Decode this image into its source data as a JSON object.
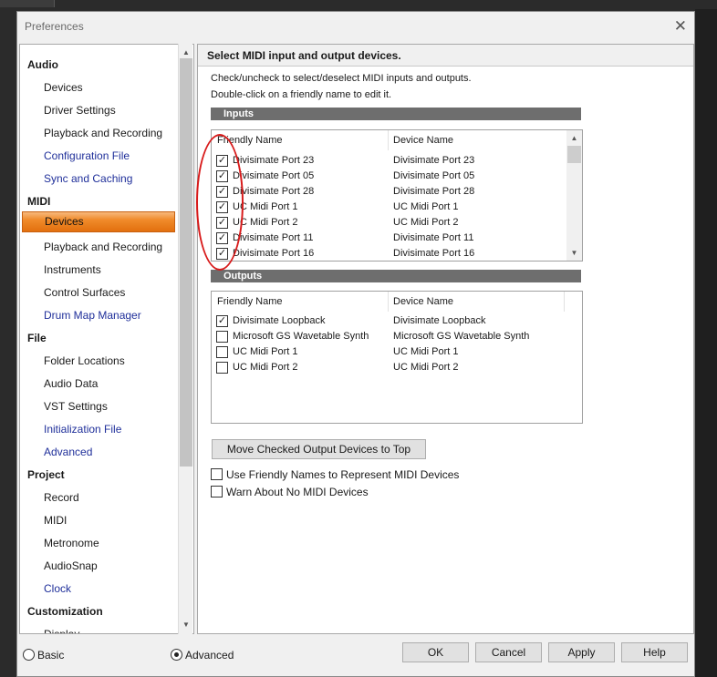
{
  "window": {
    "title": "Preferences"
  },
  "tree": [
    {
      "label": "Audio",
      "type": "cat"
    },
    {
      "label": "Devices",
      "type": "sub"
    },
    {
      "label": "Driver Settings",
      "type": "sub"
    },
    {
      "label": "Playback and Recording",
      "type": "sub"
    },
    {
      "label": "Configuration File",
      "type": "link"
    },
    {
      "label": "Sync and Caching",
      "type": "link"
    },
    {
      "label": "MIDI",
      "type": "cat"
    },
    {
      "label": "Devices",
      "type": "selected"
    },
    {
      "label": "Playback and Recording",
      "type": "sub"
    },
    {
      "label": "Instruments",
      "type": "sub"
    },
    {
      "label": "Control Surfaces",
      "type": "sub"
    },
    {
      "label": "Drum Map Manager",
      "type": "link"
    },
    {
      "label": "File",
      "type": "cat"
    },
    {
      "label": "Folder Locations",
      "type": "sub"
    },
    {
      "label": "Audio Data",
      "type": "sub"
    },
    {
      "label": "VST Settings",
      "type": "sub"
    },
    {
      "label": "Initialization File",
      "type": "link"
    },
    {
      "label": "Advanced",
      "type": "link"
    },
    {
      "label": "Project",
      "type": "cat"
    },
    {
      "label": "Record",
      "type": "sub"
    },
    {
      "label": "MIDI",
      "type": "sub"
    },
    {
      "label": "Metronome",
      "type": "sub"
    },
    {
      "label": "AudioSnap",
      "type": "sub"
    },
    {
      "label": "Clock",
      "type": "link"
    },
    {
      "label": "Customization",
      "type": "cat"
    },
    {
      "label": "Display",
      "type": "sub"
    }
  ],
  "panel": {
    "header": "Select MIDI input and output devices.",
    "instructions": [
      "Check/uncheck to select/deselect MIDI inputs and outputs.",
      "Double-click on a friendly name to edit it."
    ],
    "inputs_label": "Inputs",
    "outputs_label": "Outputs",
    "columns": {
      "friendly": "Friendly Name",
      "device": "Device Name"
    },
    "inputs": [
      {
        "friendly": "Divisimate Port 23",
        "device": "Divisimate Port 23",
        "checked": true
      },
      {
        "friendly": "Divisimate Port 05",
        "device": "Divisimate Port 05",
        "checked": true
      },
      {
        "friendly": "Divisimate Port 28",
        "device": "Divisimate Port 28",
        "checked": true
      },
      {
        "friendly": "UC Midi Port 1",
        "device": "UC Midi Port 1",
        "checked": true
      },
      {
        "friendly": "UC Midi Port 2",
        "device": "UC Midi Port 2",
        "checked": true
      },
      {
        "friendly": "Divisimate Port 11",
        "device": "Divisimate Port 11",
        "checked": true
      },
      {
        "friendly": "Divisimate Port 16",
        "device": "Divisimate Port 16",
        "checked": true
      }
    ],
    "outputs": [
      {
        "friendly": "Divisimate Loopback",
        "device": "Divisimate Loopback",
        "checked": true
      },
      {
        "friendly": "Microsoft GS Wavetable Synth",
        "device": "Microsoft GS Wavetable Synth",
        "checked": false
      },
      {
        "friendly": "UC Midi Port 1",
        "device": "UC Midi Port 1",
        "checked": false
      },
      {
        "friendly": "UC Midi Port 2",
        "device": "UC Midi Port 2",
        "checked": false
      }
    ],
    "move_button": "Move Checked Output Devices to Top",
    "options": [
      {
        "label": "Use Friendly Names to Represent MIDI Devices",
        "checked": false
      },
      {
        "label": "Warn About No MIDI Devices",
        "checked": false
      }
    ]
  },
  "bottom": {
    "basic_label": "Basic",
    "advanced_label": "Advanced",
    "mode": "advanced",
    "ok": "OK",
    "cancel": "Cancel",
    "apply": "Apply",
    "help": "Help"
  },
  "colors": {
    "selected_accent": "#f08a2a",
    "annotation": "#d81b1b",
    "link": "#1f2f9a"
  }
}
